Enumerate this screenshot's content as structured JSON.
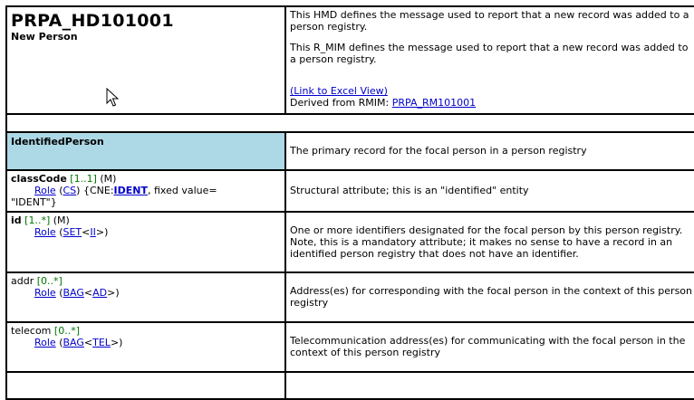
{
  "header": {
    "title": "PRPA_HD101001",
    "subtitle": "New Person",
    "desc1": "This HMD defines the message used to report that a new record was added to a person registry.",
    "desc2": "This R_MIM defines the message used to report that a new record was added to a person registry.",
    "excel_link": "(Link to Excel View)",
    "derived_label": "Derived from RMIM: ",
    "derived_link": "PRPA_RM101001"
  },
  "class_row": {
    "name": "IdentifiedPerson",
    "desc": "The primary record for the focal person in a person registry",
    "header_color": "#add8e6"
  },
  "rows": [
    {
      "name": "classCode",
      "card": "[1..1]",
      "conf": "(M)",
      "role": "Role",
      "open": "(",
      "type": "CS",
      "close": ")",
      "extra_pre": " {CNE:",
      "extra_link": "IDENT",
      "extra_post": ", fixed value=",
      "extra_line2": "\"IDENT\"}",
      "desc": "Structural attribute; this is an \"identified\" entity"
    },
    {
      "name": "id",
      "card": "[1..*]",
      "conf": "(M)",
      "role": "Role",
      "open": "(",
      "type": "SET",
      "lt": "<",
      "inner": "II",
      "gt": ">",
      "close": ")",
      "desc": "One or more identifiers designated for the focal person by this person registry. Note, this is a mandatory attribute; it makes no sense to have a record in an identified person registry that does not have an identifier."
    },
    {
      "name": "addr",
      "card": "[0..*]",
      "role": "Role",
      "open": "(",
      "type": "BAG",
      "lt": "<",
      "inner": "AD",
      "gt": ">",
      "close": ")",
      "desc": "Address(es) for corresponding with the focal person in the context of this person registry"
    },
    {
      "name": "telecom",
      "card": "[0..*]",
      "role": "Role",
      "open": "(",
      "type": "BAG",
      "lt": "<",
      "inner": "TEL",
      "gt": ">",
      "close": ")",
      "desc": "Telecommunication address(es) for communicating with the focal person in the context of this person registry"
    }
  ],
  "colors": {
    "link": "#0000cc",
    "cardinality": "#007700",
    "border": "#000000"
  },
  "icons": {
    "cursor": "mouse-pointer-icon"
  }
}
